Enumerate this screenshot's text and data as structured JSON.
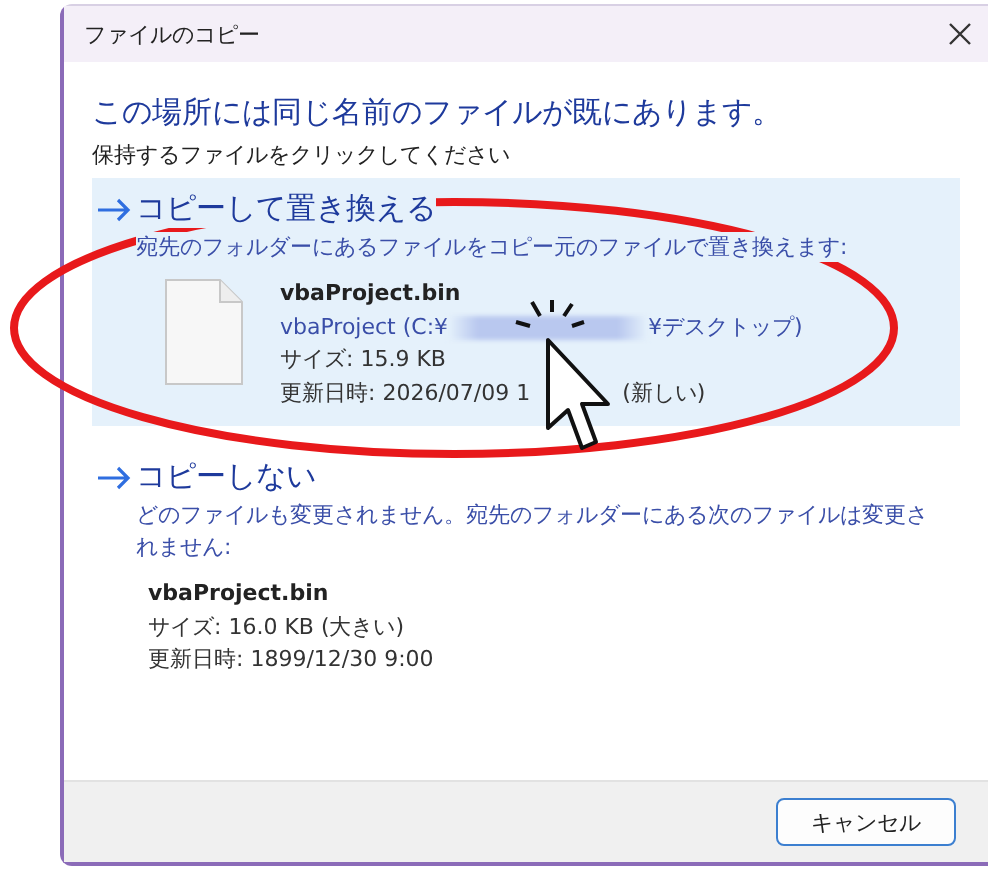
{
  "window": {
    "title": "ファイルのコピー"
  },
  "heading": "この場所には同じ名前のファイルが既にあります。",
  "instruction": "保持するファイルをクリックしてください",
  "options": [
    {
      "kind": "replace",
      "selected": true,
      "title": "コピーして置き換える",
      "description": "宛先のフォルダーにあるファイルをコピー元のファイルで置き換えます:",
      "file": {
        "name": "vbaProject.bin",
        "location_start": "vbaProject (C:¥",
        "location_end": "¥デスクトップ)",
        "size": "サイズ: 15.9 KB",
        "modified_start": "更新日時: 2026/07/09 1",
        "modified_end": "(新しい)"
      }
    },
    {
      "kind": "skip",
      "selected": false,
      "title": "コピーしない",
      "description": "どのファイルも変更されません。宛先のフォルダーにある次のファイルは変更されません:",
      "file": {
        "name": "vbaProject.bin",
        "size": "サイズ: 16.0 KB (大きい)",
        "modified_start": "更新日時: 1899/12/30 9:00"
      }
    }
  ],
  "buttons": [
    {
      "label": "キャンセル"
    }
  ]
}
